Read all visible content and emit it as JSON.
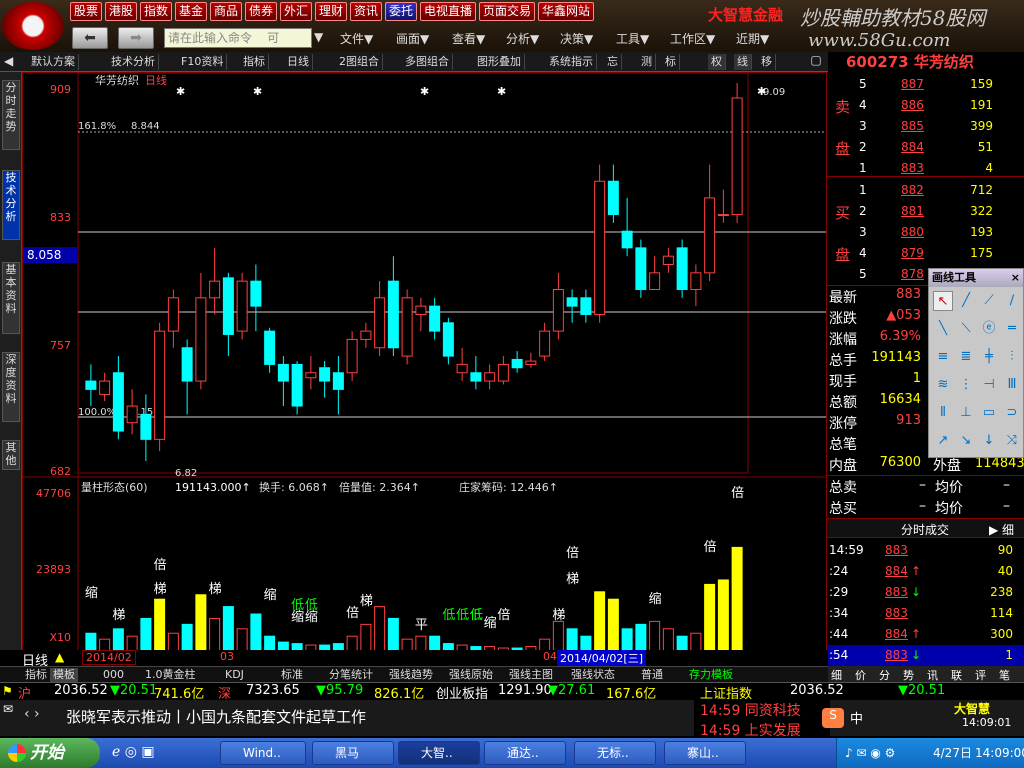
{
  "topbar": {
    "buttons": [
      "股票",
      "港股",
      "指数",
      "基金",
      "商品",
      "债券",
      "外汇",
      "理财",
      "资讯",
      "委托",
      "电视直播",
      "页面交易",
      "华鑫网站"
    ],
    "brand": "大智慧金融",
    "watermark": "炒股輔助教材58股网",
    "watermark_url": "www.58Gu.com",
    "command_placeholder": "请在此输入命令",
    "command_suffix": "可",
    "menus": [
      "文件▼",
      "画面▼",
      "查看▼",
      "分析▼",
      "决策▼",
      "工具▼",
      "工作区▼",
      "近期▼"
    ]
  },
  "toolbar": {
    "items": [
      "默认方案",
      "技术分析▼",
      "F10资料",
      "指标",
      "日线",
      "2图组合",
      "多图组合",
      "图形叠加",
      "系统指示",
      "忘",
      "测",
      "标",
      "权",
      "线",
      "移"
    ],
    "items_display": [
      "默认方案",
      "技术分析",
      "F10资料",
      "指标",
      "日线",
      "2图组合",
      "多图组合",
      "图形叠加",
      "系统指示",
      "忘",
      "测",
      "标",
      "权",
      "线",
      "移"
    ],
    "dd": [
      "▼",
      "▼",
      "▼",
      "▼",
      "▼",
      "▼"
    ]
  },
  "leftnav": [
    "分时走势",
    "技术分析",
    "基本资料",
    "深度资料",
    "其他"
  ],
  "chart": {
    "stock_name": "华芳纺织",
    "period": "日线",
    "y_labels": [
      "909",
      "833",
      "757",
      "682"
    ],
    "y_current": "8.058",
    "fib_top_label": "161.8%",
    "fib_top_value": "8.844",
    "fib_bottom_label": "100.0%",
    "fib_bottom_value": "7.151",
    "high_label": "9.09",
    "low_label": "6.82",
    "vol_indicator": "量柱形态(60)",
    "vol_values": [
      "191143.000↑",
      "换手: 6.068↑",
      "倍量值: 2.364↑",
      "庄家筹码: 12.446↑"
    ],
    "vol_y_labels": [
      "47706",
      "23893",
      "X10"
    ],
    "vol_annotations": [
      "缩",
      "梯",
      "倍",
      "梯",
      "梯",
      "缩",
      "低",
      "低",
      "缩",
      "缩",
      "倍",
      "梯",
      "平",
      "低",
      "低",
      "低",
      "低",
      "缩",
      "倍",
      "梯",
      "倍",
      "梯",
      "缩",
      "倍",
      "倍"
    ],
    "date_left": "2014/02",
    "date_mid": "03",
    "date_right": "04",
    "date_cursor": "2014/04/02[三]"
  },
  "chart_data": {
    "type": "candlestick",
    "ylim": [
      6.82,
      9.09
    ],
    "candles": [
      {
        "o": 7.3,
        "c": 7.25,
        "h": 7.4,
        "l": 7.15,
        "up": false
      },
      {
        "o": 7.22,
        "c": 7.3,
        "h": 7.35,
        "l": 7.18,
        "up": true
      },
      {
        "o": 7.35,
        "c": 7.0,
        "h": 7.45,
        "l": 6.95,
        "up": false
      },
      {
        "o": 7.05,
        "c": 7.15,
        "h": 7.25,
        "l": 6.98,
        "up": true
      },
      {
        "o": 7.1,
        "c": 6.95,
        "h": 7.22,
        "l": 6.82,
        "up": false
      },
      {
        "o": 6.95,
        "c": 7.6,
        "h": 7.65,
        "l": 6.88,
        "up": true
      },
      {
        "o": 7.6,
        "c": 7.8,
        "h": 7.85,
        "l": 7.5,
        "up": true
      },
      {
        "o": 7.5,
        "c": 7.3,
        "h": 7.55,
        "l": 7.1,
        "up": false
      },
      {
        "o": 7.3,
        "c": 7.8,
        "h": 7.95,
        "l": 7.25,
        "up": true
      },
      {
        "o": 7.8,
        "c": 7.9,
        "h": 8.1,
        "l": 7.7,
        "up": true
      },
      {
        "o": 7.92,
        "c": 7.58,
        "h": 7.95,
        "l": 7.45,
        "up": false
      },
      {
        "o": 7.6,
        "c": 7.9,
        "h": 7.95,
        "l": 7.55,
        "up": true
      },
      {
        "o": 7.9,
        "c": 7.75,
        "h": 8.0,
        "l": 7.6,
        "up": false
      },
      {
        "o": 7.6,
        "c": 7.4,
        "h": 7.62,
        "l": 7.35,
        "up": false
      },
      {
        "o": 7.4,
        "c": 7.3,
        "h": 7.45,
        "l": 7.15,
        "up": false
      },
      {
        "o": 7.4,
        "c": 7.15,
        "h": 7.42,
        "l": 7.1,
        "up": false
      },
      {
        "o": 7.35,
        "c": 7.32,
        "h": 7.45,
        "l": 7.25,
        "up": true
      },
      {
        "o": 7.38,
        "c": 7.3,
        "h": 7.42,
        "l": 7.2,
        "up": false
      },
      {
        "o": 7.35,
        "c": 7.25,
        "h": 7.45,
        "l": 7.1,
        "up": false
      },
      {
        "o": 7.35,
        "c": 7.55,
        "h": 7.6,
        "l": 7.3,
        "up": true
      },
      {
        "o": 7.55,
        "c": 7.6,
        "h": 7.65,
        "l": 7.5,
        "up": true
      },
      {
        "o": 7.5,
        "c": 7.8,
        "h": 7.9,
        "l": 7.45,
        "up": true
      },
      {
        "o": 7.9,
        "c": 7.5,
        "h": 8.05,
        "l": 7.45,
        "up": false
      },
      {
        "o": 7.45,
        "c": 7.8,
        "h": 7.85,
        "l": 7.4,
        "up": true
      },
      {
        "o": 7.75,
        "c": 7.7,
        "h": 7.8,
        "l": 7.6,
        "up": true
      },
      {
        "o": 7.75,
        "c": 7.6,
        "h": 7.8,
        "l": 7.55,
        "up": false
      },
      {
        "o": 7.65,
        "c": 7.45,
        "h": 7.68,
        "l": 7.4,
        "up": false
      },
      {
        "o": 7.4,
        "c": 7.35,
        "h": 7.5,
        "l": 7.3,
        "up": true
      },
      {
        "o": 7.35,
        "c": 7.3,
        "h": 7.45,
        "l": 7.25,
        "up": false
      },
      {
        "o": 7.3,
        "c": 7.35,
        "h": 7.4,
        "l": 7.25,
        "up": true
      },
      {
        "o": 7.3,
        "c": 7.4,
        "h": 7.45,
        "l": 7.28,
        "up": true
      },
      {
        "o": 7.43,
        "c": 7.38,
        "h": 7.48,
        "l": 7.35,
        "up": false
      },
      {
        "o": 7.4,
        "c": 7.42,
        "h": 7.47,
        "l": 7.38,
        "up": true
      },
      {
        "o": 7.45,
        "c": 7.6,
        "h": 7.65,
        "l": 7.42,
        "up": true
      },
      {
        "o": 7.6,
        "c": 7.85,
        "h": 7.95,
        "l": 7.55,
        "up": true
      },
      {
        "o": 7.8,
        "c": 7.75,
        "h": 7.85,
        "l": 7.65,
        "up": false
      },
      {
        "o": 7.8,
        "c": 7.7,
        "h": 7.85,
        "l": 7.65,
        "up": false
      },
      {
        "o": 7.7,
        "c": 8.5,
        "h": 8.6,
        "l": 7.65,
        "up": true
      },
      {
        "o": 8.5,
        "c": 8.3,
        "h": 8.6,
        "l": 8.25,
        "up": false
      },
      {
        "o": 8.2,
        "c": 8.1,
        "h": 8.4,
        "l": 8.05,
        "up": false
      },
      {
        "o": 8.1,
        "c": 7.85,
        "h": 8.15,
        "l": 7.8,
        "up": false
      },
      {
        "o": 7.85,
        "c": 7.95,
        "h": 8.05,
        "l": 7.85,
        "up": true
      },
      {
        "o": 8.0,
        "c": 8.05,
        "h": 8.1,
        "l": 7.95,
        "up": true
      },
      {
        "o": 8.1,
        "c": 7.85,
        "h": 8.15,
        "l": 7.8,
        "up": false
      },
      {
        "o": 7.85,
        "c": 7.95,
        "h": 8.0,
        "l": 7.75,
        "up": true
      },
      {
        "o": 7.95,
        "c": 8.4,
        "h": 8.6,
        "l": 7.9,
        "up": true
      },
      {
        "o": 8.3,
        "c": 8.3,
        "h": 8.45,
        "l": 8.25,
        "up": true
      },
      {
        "o": 8.3,
        "c": 9.0,
        "h": 9.09,
        "l": 8.25,
        "up": true
      }
    ],
    "volumes": [
      0.12,
      0.08,
      0.15,
      0.1,
      0.22,
      0.35,
      0.12,
      0.18,
      0.38,
      0.22,
      0.3,
      0.15,
      0.25,
      0.1,
      0.06,
      0.05,
      0.04,
      0.04,
      0.05,
      0.1,
      0.18,
      0.3,
      0.22,
      0.08,
      0.1,
      0.1,
      0.05,
      0.04,
      0.03,
      0.03,
      0.02,
      0.02,
      0.03,
      0.08,
      0.2,
      0.15,
      0.1,
      0.4,
      0.35,
      0.15,
      0.18,
      0.2,
      0.15,
      0.1,
      0.12,
      0.45,
      0.48,
      0.7
    ]
  },
  "ticker": {
    "code": "600273",
    "name": "华芳纺织"
  },
  "orderbook": {
    "sell_label_1": "卖",
    "sell_label_2": "盘",
    "buy_label_1": "买",
    "buy_label_2": "盘",
    "sells": [
      {
        "lvl": "5",
        "price": "887",
        "vol": "159"
      },
      {
        "lvl": "4",
        "price": "886",
        "vol": "191"
      },
      {
        "lvl": "3",
        "price": "885",
        "vol": "399"
      },
      {
        "lvl": "2",
        "price": "884",
        "vol": "51"
      },
      {
        "lvl": "1",
        "price": "883",
        "vol": "4"
      }
    ],
    "buys": [
      {
        "lvl": "1",
        "price": "882",
        "vol": "712"
      },
      {
        "lvl": "2",
        "price": "881",
        "vol": "322"
      },
      {
        "lvl": "3",
        "price": "880",
        "vol": "193"
      },
      {
        "lvl": "4",
        "price": "879",
        "vol": "175"
      },
      {
        "lvl": "5",
        "price": "878",
        "vol": ""
      }
    ]
  },
  "stats": [
    {
      "label": "最新",
      "value": "883"
    },
    {
      "label": "涨跌",
      "value": "▲053"
    },
    {
      "label": "涨幅",
      "value": "6.39%"
    },
    {
      "label": "总手",
      "value": "191143"
    },
    {
      "label": "现手",
      "value": "1"
    },
    {
      "label": "总额",
      "value": "16634"
    },
    {
      "label": "涨停",
      "value": "913"
    },
    {
      "label": "总笔",
      "value": ""
    },
    {
      "label": "内盘",
      "value": "76300"
    }
  ],
  "outer": {
    "label": "外盘",
    "value": "114843"
  },
  "bid_ask": [
    {
      "label": "总卖",
      "dash": "–",
      "avg": "均价"
    },
    {
      "label": "总买",
      "dash": "–",
      "avg": "均价"
    }
  ],
  "trades_header": "分时成交",
  "trades_btn": "▶ 细",
  "trades": [
    {
      "t": "14:59",
      "p": "883",
      "arrow": "",
      "v": "90"
    },
    {
      "t": ":24",
      "p": "884",
      "arrow": "↑",
      "v": "40"
    },
    {
      "t": ":29",
      "p": "883",
      "arrow": "↓",
      "v": "238"
    },
    {
      "t": ":34",
      "p": "883",
      "arrow": "",
      "v": "114"
    },
    {
      "t": ":44",
      "p": "884",
      "arrow": "↑",
      "v": "300"
    },
    {
      "t": ":54",
      "p": "883",
      "arrow": "↓",
      "v": "1"
    }
  ],
  "trades_tabs": [
    "细",
    "价",
    "分",
    "势",
    "讯",
    "联",
    "评",
    "笔"
  ],
  "drawtool": {
    "title": "画线工具",
    "close": "×"
  },
  "timetabs": [
    "日线",
    "▲"
  ],
  "bottomtabs": [
    "指标",
    "模板",
    "000",
    "1.0黄金柱",
    "KDJ",
    "标准",
    "分笔统计",
    "强线趋势",
    "强线原始",
    "强线主图",
    "强线状态",
    "普通",
    "存力模板"
  ],
  "statusbar": {
    "items": [
      {
        "t": "沪",
        "c": "red"
      },
      {
        "t": "2036.52",
        "c": "white"
      },
      {
        "t": "▼20.51",
        "c": "green"
      },
      {
        "t": "741.6亿",
        "c": "yellow"
      },
      {
        "t": "深",
        "c": "red"
      },
      {
        "t": "7323.65",
        "c": "white"
      },
      {
        "t": "▼95.79",
        "c": "green"
      },
      {
        "t": "826.1亿",
        "c": "yellow"
      },
      {
        "t": "创业板指",
        "c": "white"
      },
      {
        "t": "1291.90",
        "c": "white"
      },
      {
        "t": "▼27.61",
        "c": "green"
      },
      {
        "t": "167.6亿",
        "c": "yellow"
      },
      {
        "t": "上证指数",
        "c": "yellow"
      },
      {
        "t": "2036.52",
        "c": "white"
      },
      {
        "t": "▼20.51",
        "c": "green"
      }
    ]
  },
  "news": {
    "left": "张晓军表示推动丨小国九条配套文件起草工作",
    "right1": "14:59 同资科技",
    "right2": "14:59 上实发展",
    "time": "14:09:01",
    "logo": "大智慧"
  },
  "taskbar": {
    "start": "开始",
    "tasks": [
      "Wind..",
      "黑马",
      "大智..",
      "通达..",
      "无标..",
      "寨山.."
    ],
    "date": "4/27日",
    "time": "14:09:00"
  },
  "colors": {
    "up": "#ff4040",
    "down": "#00ffff",
    "volyellow": "#ffff00",
    "bg": "#000000",
    "border": "#880000"
  }
}
